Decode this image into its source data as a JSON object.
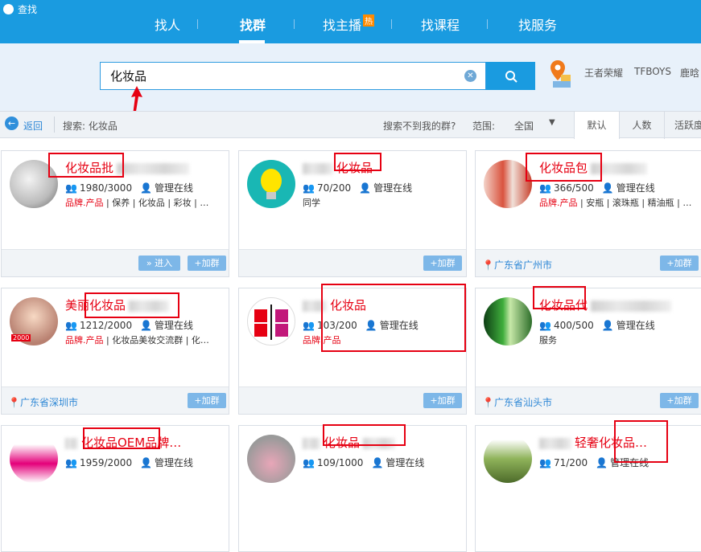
{
  "app": {
    "title": "查找"
  },
  "nav": [
    {
      "label": "找人"
    },
    {
      "label": "找群"
    },
    {
      "label": "找主播",
      "badge": "热"
    },
    {
      "label": "找课程"
    },
    {
      "label": "找服务"
    }
  ],
  "search": {
    "value": "化妆品",
    "placeholder": ""
  },
  "hot_keywords": [
    "王者荣耀",
    "TFBOYS",
    "鹿晗"
  ],
  "filter": {
    "back": "返回",
    "search_label": "搜索: 化妆品",
    "not_found": "搜索不到我的群?",
    "range_label": "范围:",
    "range_value": "全国",
    "tabs": [
      "默认",
      "人数",
      "活跃度"
    ]
  },
  "cards": [
    {
      "name": "化妆品批",
      "members": "1980/3000",
      "admin": "管理在线",
      "tags": [
        {
          "t": "品牌.产品",
          "red": true
        },
        {
          "t": "保养"
        },
        {
          "t": "化妆品"
        },
        {
          "t": "彩妆"
        },
        {
          "t": "…"
        }
      ],
      "location": "",
      "buttons": [
        "» 进入",
        "+加群"
      ]
    },
    {
      "name": "化妆品",
      "members": "70/200",
      "admin": "管理在线",
      "tags": [
        {
          "t": "同学"
        }
      ],
      "location": "",
      "buttons": [
        "+加群"
      ]
    },
    {
      "name": "化妆品包",
      "members": "366/500",
      "admin": "管理在线",
      "tags": [
        {
          "t": "品牌.产品",
          "red": true
        },
        {
          "t": "安瓶"
        },
        {
          "t": "滚珠瓶"
        },
        {
          "t": "精油瓶"
        },
        {
          "t": "…"
        }
      ],
      "location": "广东省广州市",
      "buttons": [
        "+加群"
      ]
    },
    {
      "name": "美丽化妆品",
      "members": "1212/2000",
      "admin": "管理在线",
      "tags": [
        {
          "t": "品牌.产品",
          "red": true
        },
        {
          "t": "化妆品美妆交流群"
        },
        {
          "t": "化…"
        }
      ],
      "location": "广东省深圳市",
      "buttons": [
        "+加群"
      ]
    },
    {
      "name": "化妆品",
      "members": "103/200",
      "admin": "管理在线",
      "tags": [
        {
          "t": "品牌.产品",
          "red": true
        }
      ],
      "location": "",
      "buttons": [
        "+加群"
      ]
    },
    {
      "name": "化妆品代",
      "members": "400/500",
      "admin": "管理在线",
      "tags": [
        {
          "t": "服务"
        }
      ],
      "location": "广东省汕头市",
      "buttons": [
        "+加群"
      ]
    },
    {
      "name": "化妆品OEM品牌…",
      "members": "1959/2000",
      "admin": "管理在线",
      "tags": [],
      "location": "",
      "buttons": []
    },
    {
      "name": "化妆品",
      "members": "109/1000",
      "admin": "管理在线",
      "tags": [],
      "location": "",
      "buttons": []
    },
    {
      "name": "轻奢化妆品…",
      "members": "71/200",
      "admin": "管理在线",
      "tags": [],
      "location": "",
      "buttons": []
    }
  ]
}
